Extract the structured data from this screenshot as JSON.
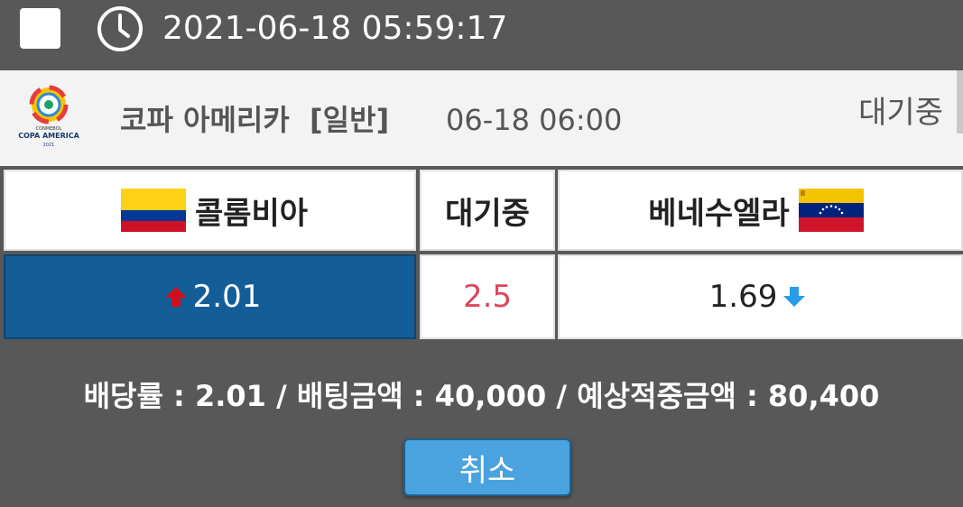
{
  "topbar": {
    "datetime": "2021-06-18 05:59:17"
  },
  "match": {
    "league_logo_text": "COPA AMERICA",
    "league_logo_sub": "CONMEBOL",
    "league_logo_year": "2021",
    "league": "코파 아메리카  [일반]",
    "kickoff": "06-18 06:00",
    "status": "대기중"
  },
  "bet_row": {
    "home_team": "콜롬비아",
    "draw_label": "대기중",
    "away_team": "베네수엘라",
    "home_odd": "2.01",
    "draw_odd": "2.5",
    "away_odd": "1.69",
    "home_trend": "up",
    "away_trend": "down"
  },
  "summary": {
    "text": "배당률 : 2.01 / 배팅금액 : 40,000 / 예상적중금액 : 80,400"
  },
  "buttons": {
    "cancel": "취소"
  },
  "colors": {
    "background": "#585858",
    "selected_cell": "#135d99",
    "draw_odd": "#e0455a",
    "cancel_button": "#4aa3de",
    "up_arrow": "#d0101a",
    "down_arrow": "#2a9bea"
  }
}
